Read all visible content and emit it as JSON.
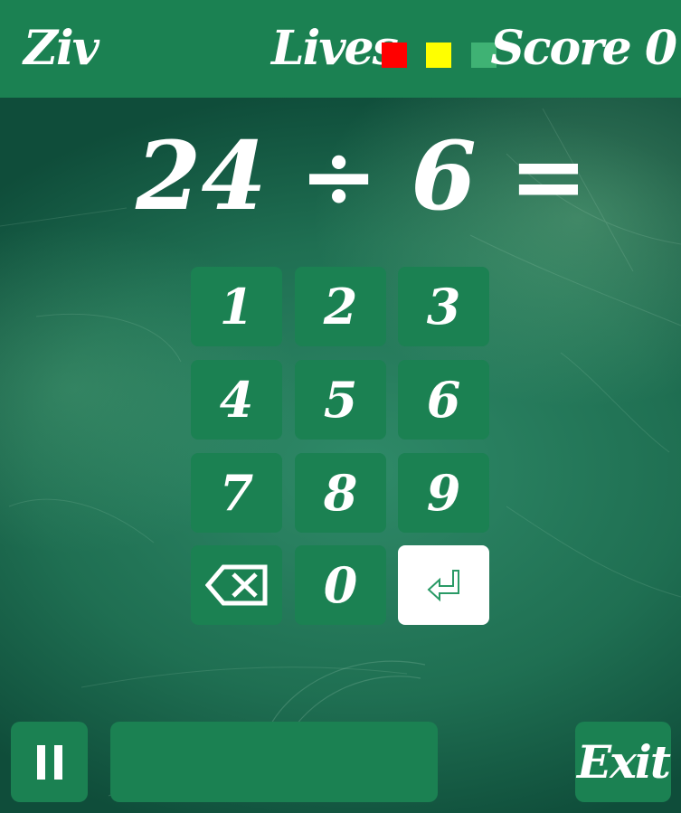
{
  "header": {
    "player_name": "Ziv",
    "lives_label": "Lives",
    "lives": [
      {
        "icon": "life-square",
        "color": "#ff0000"
      },
      {
        "icon": "life-square",
        "color": "#ffff00"
      },
      {
        "icon": "life-square",
        "color": "#3fb274"
      }
    ],
    "score_label": "Score",
    "score_value": "0"
  },
  "question": {
    "operand1": "24",
    "operator": "÷",
    "operand2": "6",
    "equals": "="
  },
  "keypad": {
    "keys": [
      "1",
      "2",
      "3",
      "4",
      "5",
      "6",
      "7",
      "8",
      "9"
    ],
    "zero": "0",
    "backspace_icon": "backspace-icon",
    "enter_icon": "enter-return-icon"
  },
  "controls": {
    "pause_icon": "pause-icon",
    "exit_label": "Exit"
  },
  "timer": {
    "progress_fraction": 0
  },
  "colors": {
    "bar_green": "#1b8152",
    "board_green": "#2a7d5f",
    "text_white": "#ffffff",
    "enter_icon_green": "#2a9a66"
  }
}
